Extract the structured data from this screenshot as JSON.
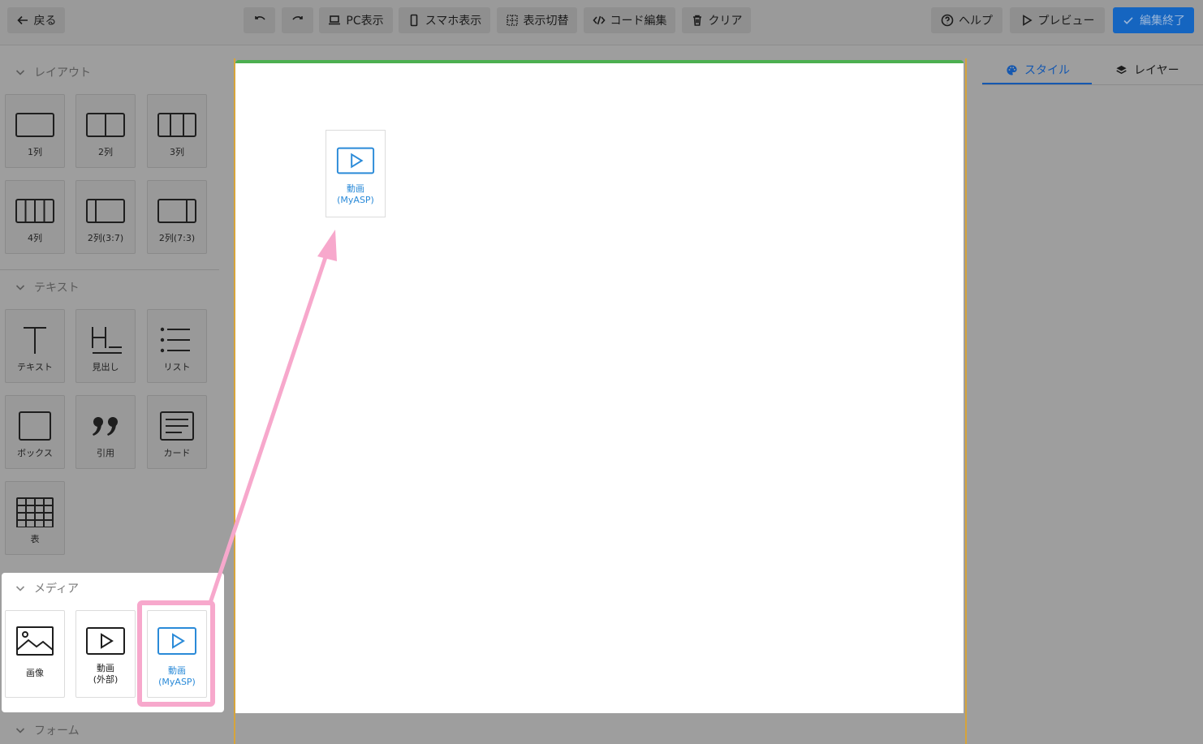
{
  "toolbar": {
    "back": "戻る",
    "pc_view": "PC表示",
    "sp_view": "スマホ表示",
    "toggle_view": "表示切替",
    "code_edit": "コード編集",
    "clear": "クリア",
    "help": "ヘルプ",
    "preview": "プレビュー",
    "finish": "編集終了"
  },
  "left": {
    "layout": {
      "title": "レイアウト",
      "items": [
        "1列",
        "2列",
        "3列",
        "4列",
        "2列(3:7)",
        "2列(7:3)"
      ]
    },
    "text": {
      "title": "テキスト",
      "items": [
        "テキスト",
        "見出し",
        "リスト",
        "ボックス",
        "引用",
        "カード",
        "表"
      ]
    },
    "media": {
      "title": "メディア",
      "items": [
        "画像",
        "動画\n(外部)",
        "動画\n(MyASP)"
      ]
    },
    "form": {
      "title": "フォーム"
    }
  },
  "canvas": {
    "dropped_label": "動画\n(MyASP)"
  },
  "right": {
    "tab_style": "スタイル",
    "tab_layer": "レイヤー"
  },
  "colors": {
    "accent": "#1565c0",
    "highlight": "#f7a8cc",
    "media_blue": "#2a8ad8",
    "canvas_border": "#d6a43a",
    "canvas_top": "#4caf50"
  }
}
